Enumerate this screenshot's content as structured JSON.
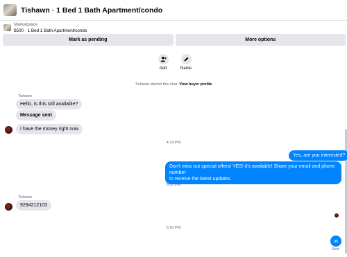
{
  "header": {
    "title": "Tishawn · 1 Bed 1 Bath Apartment/condo"
  },
  "listing": {
    "category": "Marketplace",
    "title": "$500 · 1 Bed 1 Bath Apartment/condo"
  },
  "actions": {
    "mark_pending": "Mark as pending",
    "more_options": "More options"
  },
  "tools": [
    {
      "label": "Add",
      "icon": "add-person-icon"
    },
    {
      "label": "Name",
      "icon": "pencil-icon"
    }
  ],
  "started": {
    "text": "Tishawn started this chat.",
    "link": "View buyer profile"
  },
  "conversation": {
    "buyer_name": "Tishawn",
    "buyer_msgs_1": [
      "Hello, is this still available?",
      "Message sent",
      "I have the money right now"
    ],
    "time_1": "4:14 PM",
    "seller_msgs_1": [
      "Yes, are you interested?",
      "Don't miss out special offers! YES! it's available! Share your email and phone number",
      "to receive the latest updates."
    ],
    "time_2": "6:01 PM",
    "buyer_name_2": "Tishawn",
    "buyer_msgs_2": [
      "9294212103"
    ],
    "time_3": "6:20 PM",
    "seller_msgs_2": [
      "ok"
    ],
    "status": "Sent"
  },
  "colors": {
    "accent": "#0084ff",
    "bubble_in": "#e4e6eb",
    "muted": "#65676b"
  }
}
